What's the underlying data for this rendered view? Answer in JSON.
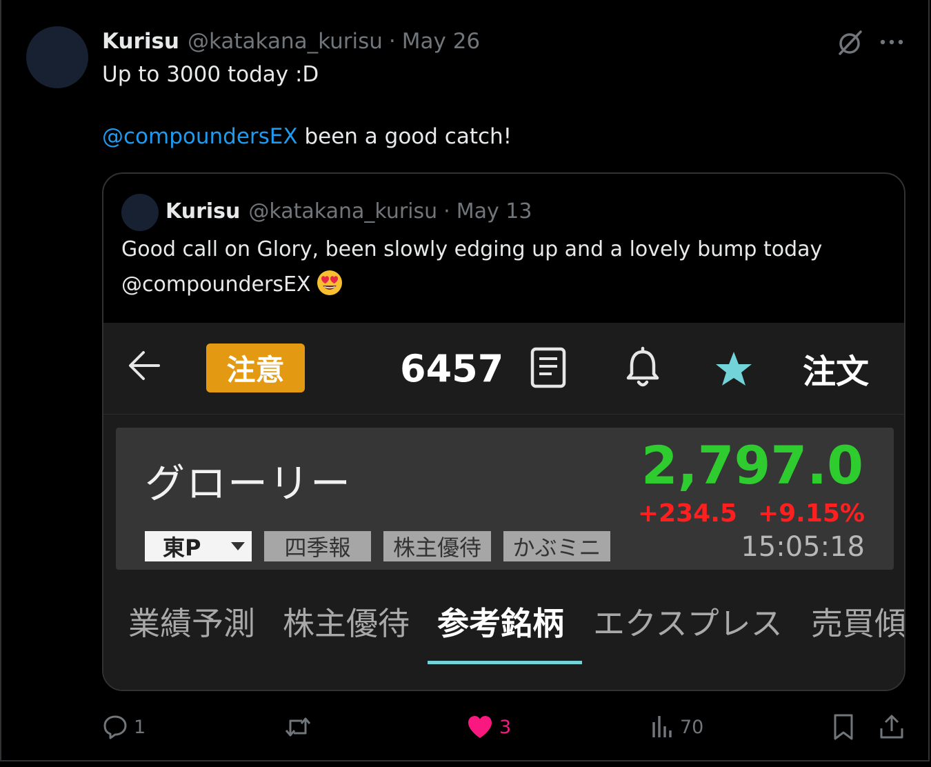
{
  "tweet": {
    "author_name": "Kurisu",
    "author_handle": "@katakana_kurisu",
    "separator": "·",
    "date": "May 26",
    "line1": "Up to 3000 today :D",
    "mention": "@compoundersEX",
    "line2_rest": " been a good catch!"
  },
  "quoted": {
    "author_name": "Kurisu",
    "author_handle": "@katakana_kurisu",
    "separator": "·",
    "date": "May 13",
    "line1": "Good call on Glory, been slowly edging up and a lovely bump today",
    "line2": "@compoundersEX",
    "emoji": "smiling-face-with-heart-eyes"
  },
  "stock_app": {
    "caution_label": "注意",
    "code": "6457",
    "order_label": "注文",
    "stock_name": "グローリー",
    "price": "2,797.0",
    "change_abs": "+234.5",
    "change_pct": "+9.15%",
    "time": "15:05:18",
    "market_tag": "東P",
    "tags": [
      "四季報",
      "株主優待",
      "かぶミニ"
    ],
    "tabs": [
      "業績予測",
      "株主優待",
      "参考銘柄",
      "エクスプレス",
      "売買傾"
    ],
    "active_tab": "参考銘柄",
    "colors": {
      "price_up": "#2ecc2e",
      "change_up": "#ff1f1f",
      "caution": "#e39a12",
      "star": "#72d3d8",
      "tab_underline": "#72d3d8"
    }
  },
  "actions": {
    "reply_count": "1",
    "retweet_count": "",
    "like_count": "3",
    "views_count": "70"
  },
  "colors": {
    "mention": "#1d9bf0",
    "like": "#f91880",
    "muted": "#71767b"
  }
}
